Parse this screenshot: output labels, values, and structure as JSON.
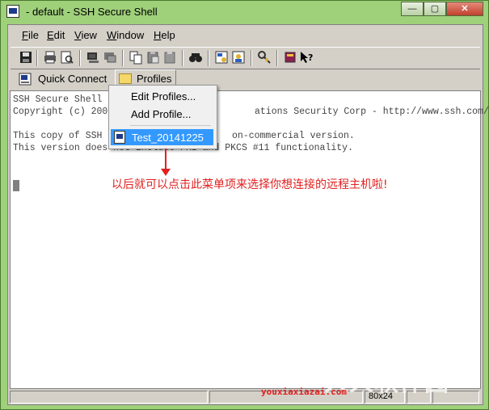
{
  "window": {
    "title": " - default - SSH Secure Shell"
  },
  "title_buttons": {
    "minimize": "—",
    "maximize": "▢",
    "close": "✕"
  },
  "menubar": [
    {
      "label": "File"
    },
    {
      "label": "Edit"
    },
    {
      "label": "View"
    },
    {
      "label": "Window"
    },
    {
      "label": "Help"
    }
  ],
  "toolbar": {
    "icons": [
      "save-icon",
      "print-icon",
      "print-preview-icon",
      "new-terminal-icon",
      "new-file-transfer-icon",
      "copy-icon",
      "paste-icon",
      "paste-special-icon",
      "find-icon",
      "settings-icon",
      "profile-icon",
      "key-icon",
      "help-book-icon",
      "whats-this-icon"
    ]
  },
  "quick_connect": {
    "label": "Quick Connect"
  },
  "profiles": {
    "label": "Profiles"
  },
  "terminal": {
    "lines": [
      "SSH Secure Shell",
      "Copyright (c) 200",
      "",
      "This copy of SSH",
      "This version does not include PKI and PKCS #11 functionality."
    ],
    "line2_tail": "ations Security Corp - http://www.ssh.com/",
    "line4_tail": "on-commercial version."
  },
  "profiles_menu": {
    "items": [
      {
        "label": "Edit Profiles...",
        "underline": "E"
      },
      {
        "label": "Add Profile...",
        "underline": "A"
      }
    ],
    "saved": [
      {
        "label": "Test_20141225",
        "selected": true
      }
    ]
  },
  "annotation": {
    "text": "以后就可以点击此菜单项来选择你想连接的远程主机啦!",
    "color": "#e02020"
  },
  "statusbar": {
    "size": "80x24"
  },
  "watermark": {
    "url": "youxiaxiazai.com",
    "logo": "人人软件园"
  },
  "colors": {
    "window_frame": "#9fd07a",
    "menu_highlight": "#3399ff",
    "client_bg": "#d4d0c8"
  }
}
